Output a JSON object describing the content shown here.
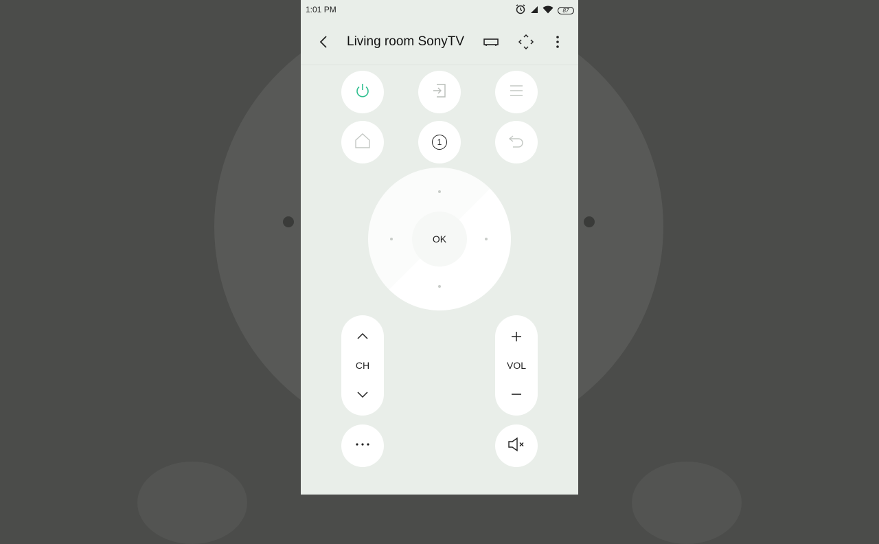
{
  "status": {
    "time": "1:01 PM",
    "battery": "87"
  },
  "appbar": {
    "title": "Living room SonyTV"
  },
  "remote": {
    "input_number": "1",
    "ok_label": "OK",
    "channel_label": "CH",
    "volume_label": "VOL"
  },
  "colors": {
    "power_accent": "#2fbf8f",
    "background": "#e9eee9"
  }
}
